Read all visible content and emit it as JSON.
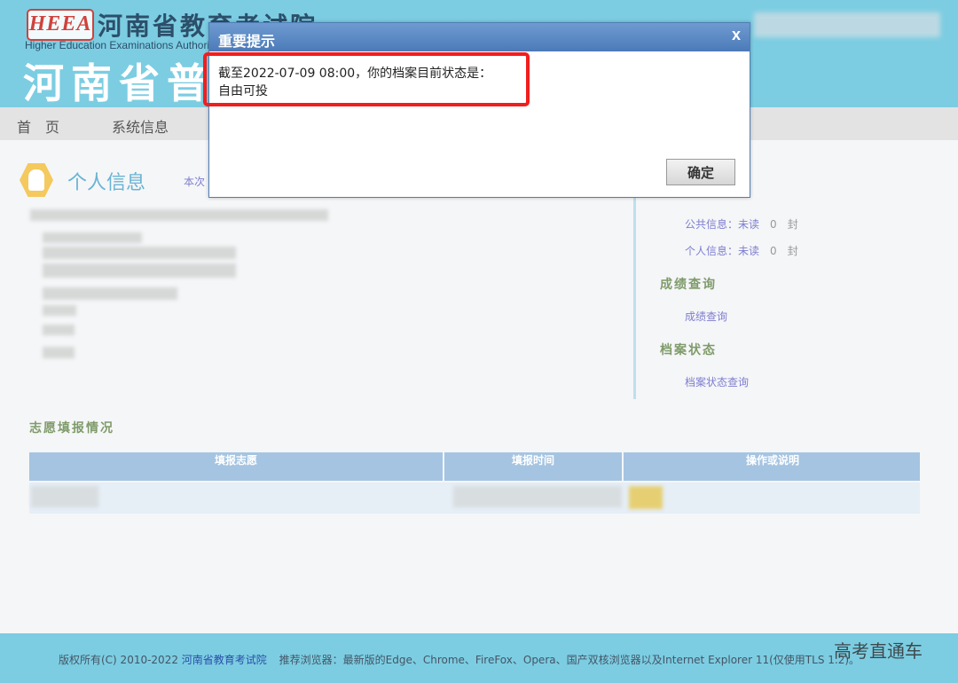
{
  "header": {
    "logo_text": "HEEA",
    "org_name_cn": "河南省教育考试院",
    "org_name_en": "Higher Education Examinations Authority",
    "site_title": "河南省普"
  },
  "nav": {
    "items": [
      {
        "label": "首　页"
      },
      {
        "label": "系统信息"
      }
    ]
  },
  "personal_info": {
    "title": "个人信息",
    "note": "本次"
  },
  "sidebar": {
    "public_info_label": "公共信息：未读",
    "public_info_count": "0",
    "public_info_unit": "封",
    "personal_info_label": "个人信息：未读",
    "personal_info_count": "0",
    "personal_info_unit": "封",
    "score_heading": "成绩查询",
    "score_link": "成绩查询",
    "archive_heading": "档案状态",
    "archive_link": "档案状态查询"
  },
  "volunteer": {
    "section_title": "志愿填报情况",
    "columns": [
      "填报志愿",
      "填报时间",
      "操作或说明"
    ]
  },
  "footer": {
    "copyright": "版权所有(C) 2010-2022",
    "org_link": "河南省教育考试院",
    "browser_note": "推荐浏览器：最新版的Edge、Chrome、FireFox、Opera、国产双核浏览器以及Internet Explorer 11(仅使用TLS 1.2)。"
  },
  "watermark": "高考直通车",
  "modal": {
    "title": "重要提示",
    "close": "x",
    "message_line1": "截至2022-07-09 08:00，你的档案目前状态是：",
    "message_line2": "自由可投",
    "ok_label": "确定"
  },
  "colors": {
    "header_bg": "#7ccde2",
    "table_header_bg": "#a5c4e1",
    "highlight_border": "#f21d1d",
    "modal_header": "#4b7ab8"
  }
}
